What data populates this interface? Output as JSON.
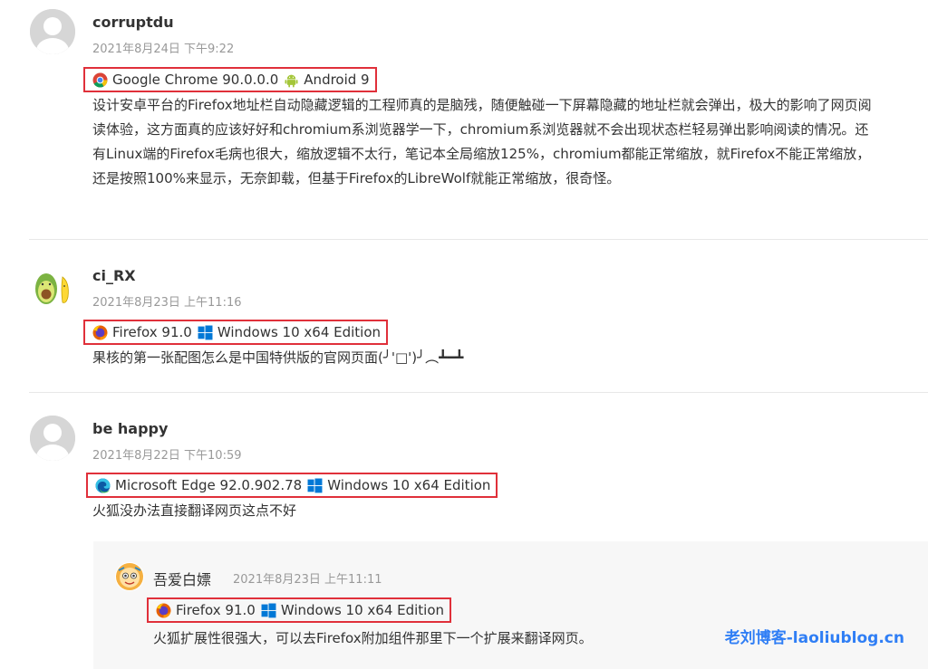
{
  "comments": [
    {
      "author": "corruptdu",
      "date": "2021年8月24日 下午9:22",
      "browser": "Google Chrome 90.0.0.0",
      "browser_icon": "chrome-icon",
      "os": "Android 9",
      "os_icon": "android-icon",
      "text": "设计安卓平台的Firefox地址栏自动隐藏逻辑的工程师真的是脑残，随便触碰一下屏幕隐藏的地址栏就会弹出，极大的影响了网页阅读体验，这方面真的应该好好和chromium系浏览器学一下，chromium系浏览器就不会出现状态栏轻易弹出影响阅读的情况。还有Linux端的Firefox毛病也很大，缩放逻辑不太行，笔记本全局缩放125%，chromium都能正常缩放，就Firefox不能正常缩放，还是按照100%来显示，无奈卸载，但基于Firefox的LibreWolf就能正常缩放，很奇怪。"
    },
    {
      "author": "ci_RX",
      "date": "2021年8月23日 上午11:16",
      "browser": "Firefox 91.0",
      "browser_icon": "firefox-icon",
      "os": "Windows 10 x64 Edition",
      "os_icon": "windows-icon",
      "text": "果核的第一张配图怎么是中国特供版的官网页面(╯'□')╯︵┻━┻"
    },
    {
      "author": "be happy",
      "date": "2021年8月22日 下午10:59",
      "browser": "Microsoft Edge 92.0.902.78",
      "browser_icon": "edge-icon",
      "os": "Windows 10 x64 Edition",
      "os_icon": "windows-icon",
      "text": "火狐没办法直接翻译网页这点不好"
    }
  ],
  "reply": {
    "author": "吾爱白嫖",
    "date": "2021年8月23日 上午11:11",
    "browser": "Firefox 91.0",
    "browser_icon": "firefox-icon",
    "os": "Windows 10 x64 Edition",
    "os_icon": "windows-icon",
    "text": "火狐扩展性很强大，可以去Firefox附加组件那里下一个扩展来翻译网页。"
  },
  "watermark": "老刘博客-laoliublog.cn",
  "colors": {
    "highlight_border": "#e0303a",
    "watermark": "#2f7ef5",
    "date": "#999999",
    "reply_background": "#f7f7f7"
  }
}
